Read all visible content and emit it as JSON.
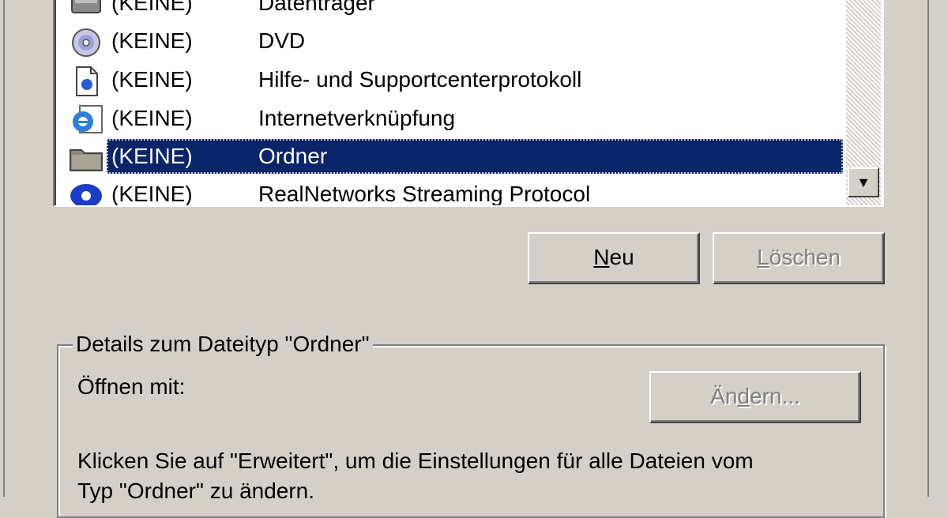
{
  "file_types": {
    "rows": [
      {
        "extension": "(KEINE)",
        "type": "Datenträger",
        "icon": "drive-icon"
      },
      {
        "extension": "(KEINE)",
        "type": "DVD",
        "icon": "dvd-icon"
      },
      {
        "extension": "(KEINE)",
        "type": "Hilfe- und Supportcenterprotokoll",
        "icon": "help-document-icon"
      },
      {
        "extension": "(KEINE)",
        "type": "Internetverknüpfung",
        "icon": "internet-explorer-icon"
      },
      {
        "extension": "(KEINE)",
        "type": "Ordner",
        "icon": "folder-icon",
        "selected": true
      },
      {
        "extension": "(KEINE)",
        "type": "RealNetworks Streaming Protocol",
        "icon": "realplayer-icon"
      }
    ],
    "scroll_down_glyph": "▼"
  },
  "buttons": {
    "new_label_accel": "N",
    "new_label_rest": "eu",
    "delete_label_accel": "L",
    "delete_label_rest": "öschen",
    "change_label_pre": "Än",
    "change_label_accel": "d",
    "change_label_post": "ern..."
  },
  "details": {
    "legend": "Details zum Dateityp \"Ordner\"",
    "open_with_label": "Öffnen mit:",
    "hint_line1": "Klicken Sie auf \"Erweitert\", um die Einstellungen für alle Dateien vom",
    "hint_line2": "Typ \"Ordner\" zu ändern."
  },
  "colors": {
    "selection": "#0a246a",
    "dialog_bg": "#d4d0c8"
  }
}
